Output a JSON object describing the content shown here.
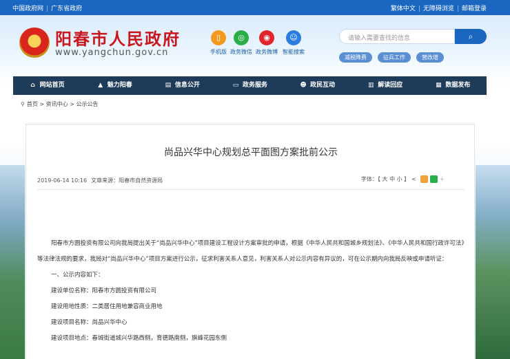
{
  "topbar": {
    "left": [
      "中国政府网",
      "广东省政府"
    ],
    "right": [
      "繁体中文",
      "无障碍浏览",
      "邮箱登录"
    ]
  },
  "header": {
    "title": "阳春市人民政府",
    "url": "www.yangchun.gov.cn",
    "quick_links": [
      {
        "label": "手机版",
        "icon": "mobile-icon",
        "color": "#f39a1e"
      },
      {
        "label": "政务微信",
        "icon": "wechat-icon",
        "color": "#2aae48"
      },
      {
        "label": "政务微博",
        "icon": "weibo-icon",
        "color": "#e0262c"
      },
      {
        "label": "智能搜索",
        "icon": "robot-icon",
        "color": "#2b7de0"
      }
    ],
    "search_placeholder": "请输入需要查找的信息",
    "hot_tags": [
      "减税降费",
      "征兵工作",
      "营改增"
    ]
  },
  "nav": [
    {
      "label": "网站首页",
      "icon": "home-icon"
    },
    {
      "label": "魅力阳春",
      "icon": "mountain-icon"
    },
    {
      "label": "信息公开",
      "icon": "document-icon"
    },
    {
      "label": "政务服务",
      "icon": "monitor-icon"
    },
    {
      "label": "政民互动",
      "icon": "people-icon"
    },
    {
      "label": "解读回应",
      "icon": "book-icon"
    },
    {
      "label": "数据发布",
      "icon": "chart-icon"
    }
  ],
  "breadcrumb": [
    "首页",
    "资讯中心",
    "公示公告"
  ],
  "article": {
    "title": "尚品兴华中心规划总平面图方案批前公示",
    "date": "2019-06-14 10:16",
    "source": "文章来源：阳春市自然资源局",
    "font_label": "字体：【 大 中 小 】",
    "paragraph1": "阳春市方圆投资有限公司向我局提出关于“尚品兴华中心”项目建设工程设计方案审批的申请，根据《中华人民共和国城乡规划法》、《中华人民共和国行政许可法》等法律法规的要求，我局对“尚品兴华中心”项目方案进行公示，征求利害关系人意见，利害关系人对公示内容有异议的，可在公示期内向我局反映或申请听证：",
    "section1": "一、公示内容如下：",
    "lines": [
      "建设单位名称：阳春市方圆投资有限公司",
      "建设用地性质：二类居住用地兼容商业用地",
      "建设项目名称：尚品兴华中心",
      "建设项目地点：春城街道城兴华路西侧，育德路南侧，旗峰花园东侧"
    ]
  },
  "colors": {
    "topbar": "#1b66c0",
    "nav": "#1e3b59",
    "title_red": "#c8181e"
  }
}
